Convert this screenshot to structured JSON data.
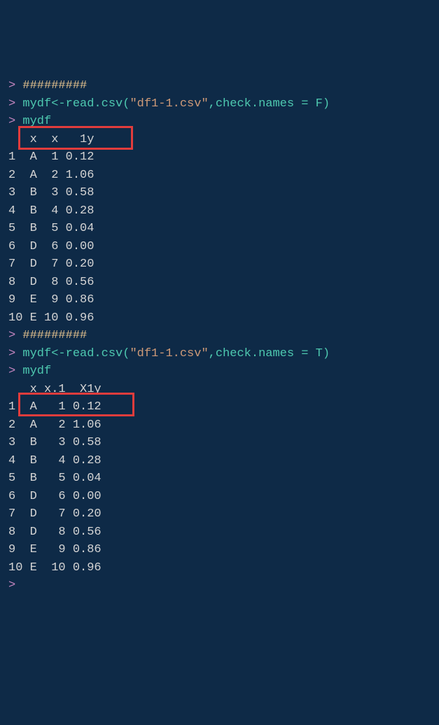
{
  "session": {
    "commentPrefix": "#",
    "commentHashes": "#########",
    "promptChar": ">",
    "readcsv_false": "mydf<-read.csv(\"df1-1.csv\",check.names = F)",
    "readcsv_true": "mydf<-read.csv(\"df1-1.csv\",check.names = T)",
    "callVar": "mydf"
  },
  "table1": {
    "header": "   x  x   1y",
    "rows": [
      "1  A  1 0.12",
      "2  A  2 1.06",
      "3  B  3 0.58",
      "4  B  4 0.28",
      "5  B  5 0.04",
      "6  D  6 0.00",
      "7  D  7 0.20",
      "8  D  8 0.56",
      "9  E  9 0.86",
      "10 E 10 0.96"
    ]
  },
  "table2": {
    "header": "   x x.1  X1y",
    "rows": [
      "1  A   1 0.12",
      "2  A   2 1.06",
      "3  B   3 0.58",
      "4  B   4 0.28",
      "5  B   5 0.04",
      "6  D   6 0.00",
      "7  D   7 0.20",
      "8  D   8 0.56",
      "9  E   9 0.86",
      "10 E  10 0.96"
    ]
  },
  "chart_data": {
    "type": "table",
    "description": "Two R dataframe printouts comparing column name handling with check.names=F vs T",
    "dataset_F": {
      "columns": [
        "x",
        "x",
        "1y"
      ],
      "rows": [
        [
          "A",
          1,
          0.12
        ],
        [
          "A",
          2,
          1.06
        ],
        [
          "B",
          3,
          0.58
        ],
        [
          "B",
          4,
          0.28
        ],
        [
          "B",
          5,
          0.04
        ],
        [
          "D",
          6,
          0.0
        ],
        [
          "D",
          7,
          0.2
        ],
        [
          "D",
          8,
          0.56
        ],
        [
          "E",
          9,
          0.86
        ],
        [
          "E",
          10,
          0.96
        ]
      ]
    },
    "dataset_T": {
      "columns": [
        "x",
        "x.1",
        "X1y"
      ],
      "rows": [
        [
          "A",
          1,
          0.12
        ],
        [
          "A",
          2,
          1.06
        ],
        [
          "B",
          3,
          0.58
        ],
        [
          "B",
          4,
          0.28
        ],
        [
          "B",
          5,
          0.04
        ],
        [
          "D",
          6,
          0.0
        ],
        [
          "D",
          7,
          0.2
        ],
        [
          "D",
          8,
          0.56
        ],
        [
          "E",
          9,
          0.86
        ],
        [
          "E",
          10,
          0.96
        ]
      ]
    }
  }
}
